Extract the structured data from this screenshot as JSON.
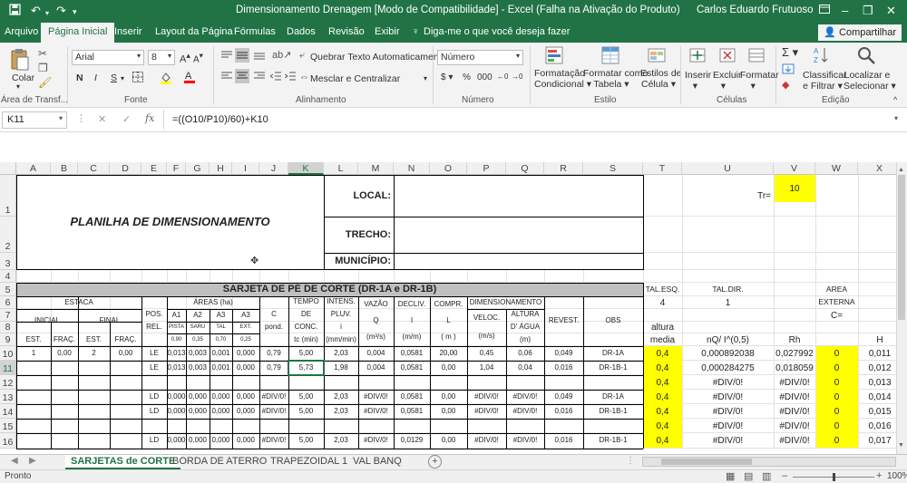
{
  "window": {
    "title": "Dimensionamento Drenagem  [Modo de Compatibilidade] - Excel (Falha na Ativação do Produto)",
    "user": "Carlos Eduardo Frutuoso"
  },
  "ribbon_tabs": [
    "Arquivo",
    "Página Inicial",
    "Inserir",
    "Layout da Página",
    "Fórmulas",
    "Dados",
    "Revisão",
    "Exibir"
  ],
  "tell_me": "Diga-me o que você deseja fazer",
  "share_label": "Compartilhar",
  "ribbon": {
    "paste_label": "Colar",
    "font_name": "Arial",
    "font_size": "8",
    "bold": "N",
    "italic": "I",
    "underline": "S",
    "wrap_text": "Quebrar Texto Automaticamente",
    "merge_center": "Mesclar e Centralizar",
    "number_format": "Número",
    "cond_format": [
      "Formatação",
      "Condicional"
    ],
    "format_table": [
      "Formatar como",
      "Tabela"
    ],
    "cell_styles": [
      "Estilos de",
      "Célula"
    ],
    "insert": "Inserir",
    "delete": "Excluir",
    "format": "Formatar",
    "sort_filter": [
      "Classificar",
      "e Filtrar"
    ],
    "find_select": [
      "Localizar e",
      "Selecionar"
    ],
    "groups": [
      "Área de Transf...",
      "Fonte",
      "Alinhamento",
      "Número",
      "Estilo",
      "Células",
      "Edição"
    ],
    "colors": {
      "accent": "#217346",
      "highlight": "#ffff00"
    }
  },
  "formula_bar": {
    "name_box": "K11",
    "formula": "=((O10/P10)/60)+K10"
  },
  "columns": [
    "A",
    "B",
    "C",
    "D",
    "E",
    "F",
    "G",
    "H",
    "I",
    "J",
    "K",
    "L",
    "M",
    "N",
    "O",
    "P",
    "Q",
    "R",
    "S",
    "T",
    "U",
    "V",
    "W",
    "X"
  ],
  "rows": [
    "1",
    "2",
    "3",
    "4",
    "5",
    "6",
    "7",
    "8",
    "9",
    "10",
    "11",
    "12",
    "13",
    "14",
    "15",
    "16"
  ],
  "sheet": {
    "title": "PLANILHA DE DIMENSIONAMENTO",
    "local": "LOCAL:",
    "trecho": "TRECHO:",
    "municipio": "MUNICÍPIO:",
    "tr_label": "Tr=",
    "tr_value": "10",
    "section_title": "SARJETA DE PÉ DE CORTE  (DR-1A  e  DR-1B)",
    "h_estaca": "ESTACA",
    "h_inicial": "INICIAL",
    "h_final": "FINAL",
    "h_est": "EST.",
    "h_frac": "FRAÇ.",
    "h_pos": [
      "POS.",
      "REL."
    ],
    "h_areas": "ÁREAS (ha)",
    "h_a1": "A1",
    "h_a2": "A2",
    "h_a3": "A3",
    "h_a3b": "A3",
    "h_pista": "PISTA",
    "h_saru": "SARU",
    "h_tal": "TAL",
    "h_ext": "EXT.",
    "h_cp": [
      "0,90",
      "0,35",
      "0,70",
      "0,25"
    ],
    "h_c": [
      "C",
      "pond."
    ],
    "h_tempo": [
      "TEMPO",
      "DE",
      "CONC.",
      "tc (min)"
    ],
    "h_intens": [
      "INTENS.",
      "PLUV.",
      "i",
      "(mm/min)"
    ],
    "h_vazao": [
      "VAZÃO",
      "Q",
      "(m³/s)"
    ],
    "h_decliv": [
      "DECLIV.",
      "I",
      "(m/m)"
    ],
    "h_compr": [
      "COMPR.",
      "L",
      "( m )"
    ],
    "h_dimens": "DIMENSIONAMENTO",
    "h_veloc": [
      "VELOC.",
      "(m/s)"
    ],
    "h_altura": [
      "ALTURA",
      "D' ÁGUA",
      "(m)"
    ],
    "h_revest": "REVEST.",
    "h_obs": "OBS",
    "tal_esq": "TAL.ESQ.",
    "tal_dir": "TAL.DIR.",
    "area": "AREA",
    "externa": "EXTERNA",
    "c_eq": "C=",
    "tal_esq_val": "4",
    "tal_dir_val": "1",
    "altura": "altura",
    "media": "media",
    "nq": "nQ/ I^(0,5)",
    "rh": "Rh",
    "hcol": "H",
    "data_rows": [
      {
        "row": "10",
        "a": "1",
        "b": "0,00",
        "c": "2",
        "d": "0,00",
        "e": "LE",
        "f": "0,013",
        "g": "0,003",
        "h": "0,001",
        "i": "0,000",
        "j": "0,79",
        "k": "5,00",
        "l": "2,03",
        "m": "0,004",
        "n": "0,0581",
        "o": "20,00",
        "p": "0,45",
        "q": "0,06",
        "r": "0,049",
        "s": "DR-1A",
        "t": "0,4",
        "u": "0,000892038",
        "v": "0,027992",
        "w": "0",
        "x": "0,011"
      },
      {
        "row": "11",
        "a": "",
        "b": "",
        "c": "",
        "d": "",
        "e": "LE",
        "f": "0,013",
        "g": "0,003",
        "h": "0,001",
        "i": "0,000",
        "j": "0,79",
        "k": "5,73",
        "l": "1,98",
        "m": "0,004",
        "n": "0,0581",
        "o": "0,00",
        "p": "1,04",
        "q": "0,04",
        "r": "0,016",
        "s": "DR-1B-1",
        "t": "0,4",
        "u": "0,000284275",
        "v": "0,018059",
        "w": "0",
        "x": "0,012"
      },
      {
        "row": "12",
        "a": "",
        "b": "",
        "c": "",
        "d": "",
        "e": "",
        "f": "",
        "g": "",
        "h": "",
        "i": "",
        "j": "",
        "k": "",
        "l": "",
        "m": "",
        "n": "",
        "o": "",
        "p": "",
        "q": "",
        "r": "",
        "s": "",
        "t": "0,4",
        "u": "#DIV/0!",
        "v": "#DIV/0!",
        "w": "0",
        "x": "0,013"
      },
      {
        "row": "13",
        "a": "",
        "b": "",
        "c": "",
        "d": "",
        "e": "LD",
        "f": "0,000",
        "g": "0,000",
        "h": "0,000",
        "i": "0,000",
        "j": "#DIV/0!",
        "k": "5,00",
        "l": "2,03",
        "m": "#DIV/0!",
        "n": "0,0581",
        "o": "0,00",
        "p": "#DIV/0!",
        "q": "#DIV/0!",
        "r": "0,049",
        "s": "DR-1A",
        "t": "0,4",
        "u": "#DIV/0!",
        "v": "#DIV/0!",
        "w": "0",
        "x": "0,014"
      },
      {
        "row": "14",
        "a": "",
        "b": "",
        "c": "",
        "d": "",
        "e": "LD",
        "f": "0,000",
        "g": "0,000",
        "h": "0,000",
        "i": "0,000",
        "j": "#DIV/0!",
        "k": "5,00",
        "l": "2,03",
        "m": "#DIV/0!",
        "n": "0,0581",
        "o": "0,00",
        "p": "#DIV/0!",
        "q": "#DIV/0!",
        "r": "0,016",
        "s": "DR-1B-1",
        "t": "0,4",
        "u": "#DIV/0!",
        "v": "#DIV/0!",
        "w": "0",
        "x": "0,015"
      },
      {
        "row": "15",
        "a": "",
        "b": "",
        "c": "",
        "d": "",
        "e": "",
        "f": "",
        "g": "",
        "h": "",
        "i": "",
        "j": "",
        "k": "",
        "l": "",
        "m": "",
        "n": "",
        "o": "",
        "p": "",
        "q": "",
        "r": "",
        "s": "",
        "t": "0,4",
        "u": "#DIV/0!",
        "v": "#DIV/0!",
        "w": "0",
        "x": "0,016"
      },
      {
        "row": "16",
        "a": "",
        "b": "",
        "c": "",
        "d": "",
        "e": "LD",
        "f": "0,000",
        "g": "0,000",
        "h": "0,000",
        "i": "0,000",
        "j": "#DIV/0!",
        "k": "5,00",
        "l": "2,03",
        "m": "#DIV/0!",
        "n": "0,0129",
        "o": "0,00",
        "p": "#DIV/0!",
        "q": "#DIV/0!",
        "r": "0,016",
        "s": "DR-1B-1",
        "t": "0,4",
        "u": "#DIV/0!",
        "v": "#DIV/0!",
        "w": "0",
        "x": "0,017"
      }
    ]
  },
  "sheet_tabs": [
    "SARJETAS de CORTE",
    "BORDA DE ATERRO",
    "TRAPEZOIDAL 1",
    "VAL BANQ"
  ],
  "status": {
    "ready": "Pronto",
    "zoom": "100%"
  }
}
